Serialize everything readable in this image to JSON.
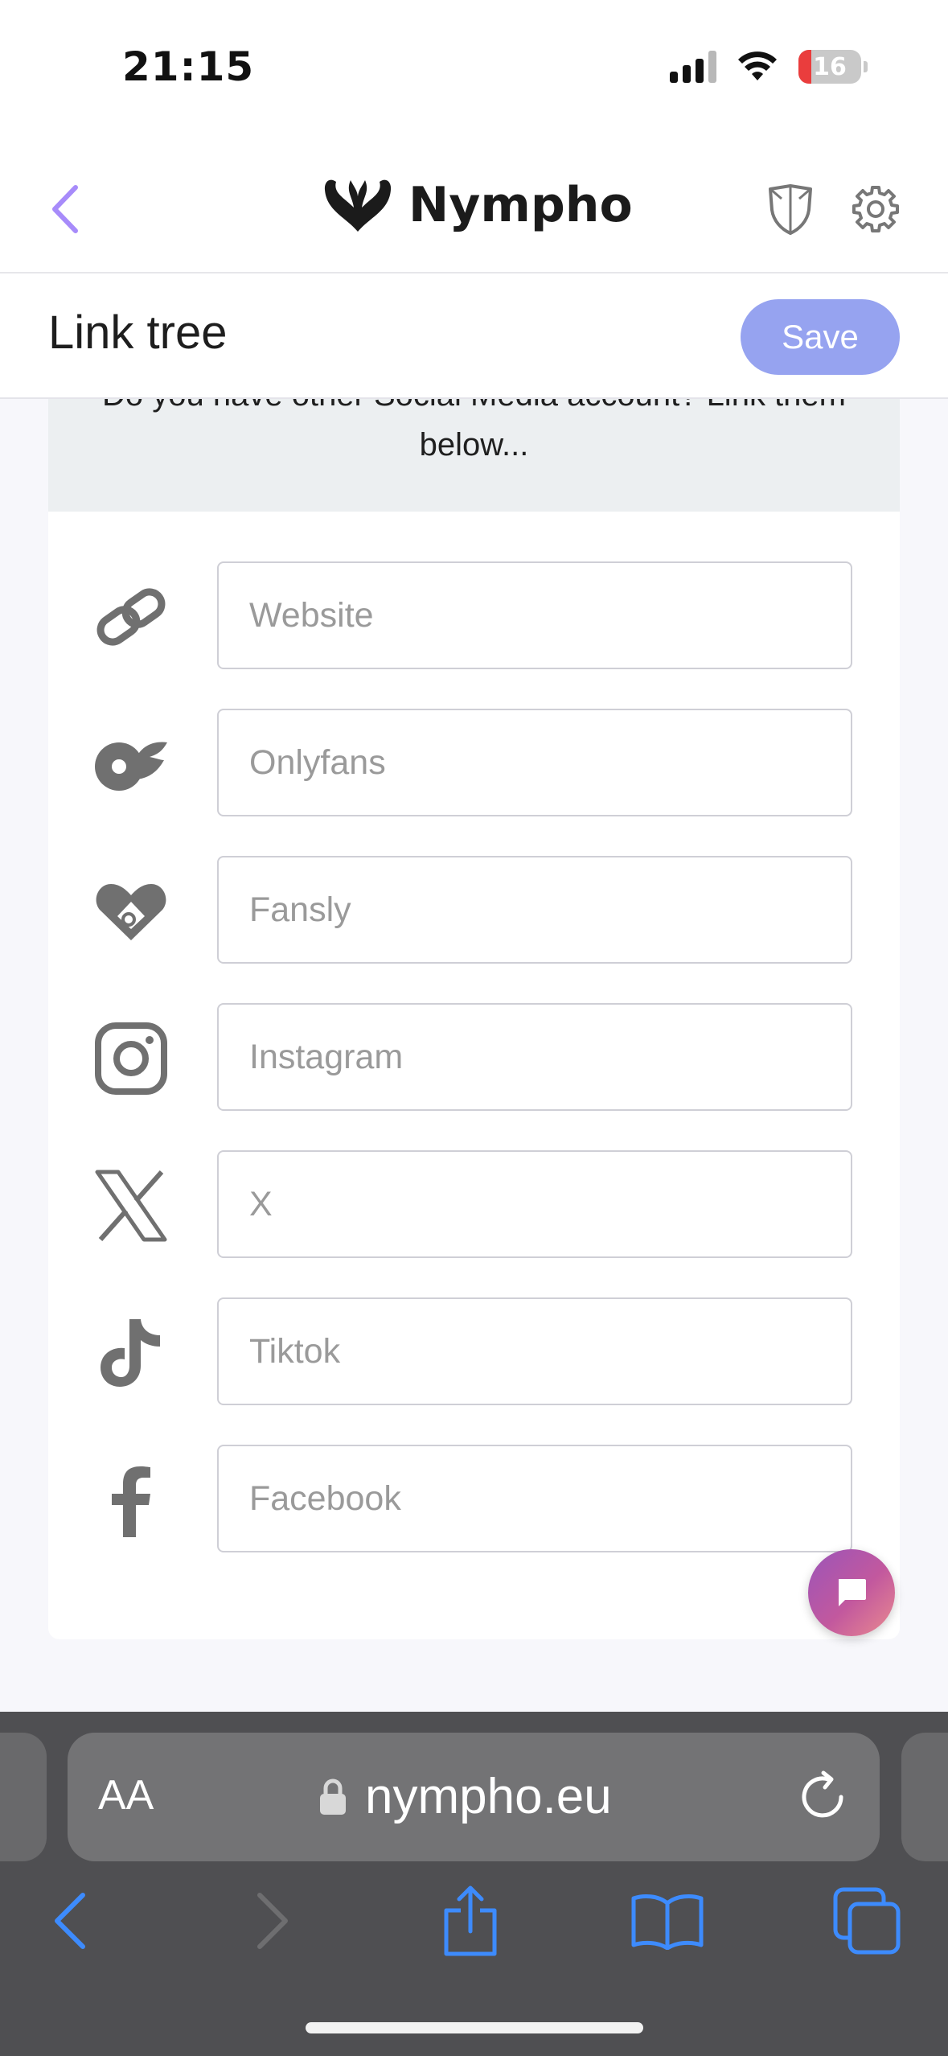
{
  "status_bar": {
    "time": "21:15",
    "battery_level": "16",
    "icons": [
      "signal-icon",
      "wifi-icon",
      "battery-icon"
    ]
  },
  "header": {
    "brand": "Nympho",
    "icons": [
      "back-chevron-icon",
      "logo-icon",
      "shield-icon",
      "gear-icon"
    ],
    "accent_color": "#a78bfa"
  },
  "subheader": {
    "title": "Link tree",
    "save_label": "Save",
    "save_color": "#96a3f0"
  },
  "intro": {
    "text": "Do you have other Social Media account? Link them below..."
  },
  "links": [
    {
      "icon": "link-icon",
      "placeholder": "Website",
      "value": ""
    },
    {
      "icon": "onlyfans-icon",
      "placeholder": "Onlyfans",
      "value": ""
    },
    {
      "icon": "fansly-icon",
      "placeholder": "Fansly",
      "value": ""
    },
    {
      "icon": "instagram-icon",
      "placeholder": "Instagram",
      "value": ""
    },
    {
      "icon": "x-icon",
      "placeholder": "X",
      "value": ""
    },
    {
      "icon": "tiktok-icon",
      "placeholder": "Tiktok",
      "value": ""
    },
    {
      "icon": "facebook-icon",
      "placeholder": "Facebook",
      "value": ""
    }
  ],
  "browser": {
    "text_size_label": "AA",
    "url": "nympho.eu",
    "icons": [
      "lock-icon",
      "reload-icon",
      "back-icon",
      "forward-icon",
      "share-icon",
      "bookmarks-icon",
      "tabs-icon"
    ],
    "button_color": "#3d8bfd"
  }
}
